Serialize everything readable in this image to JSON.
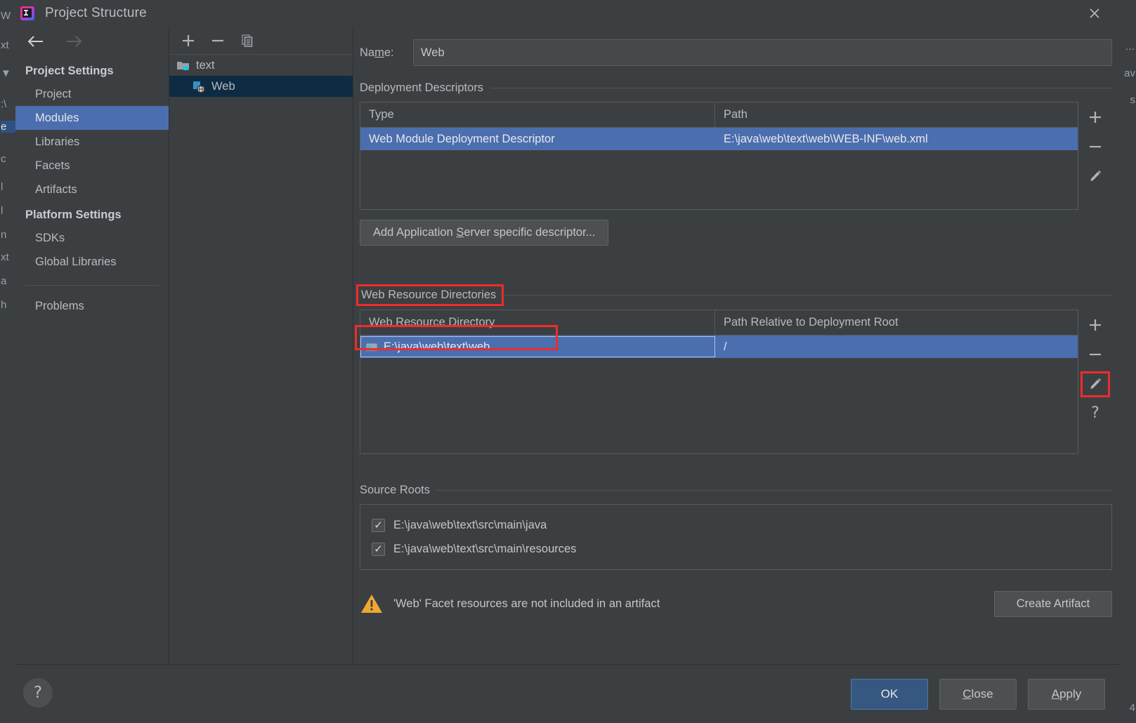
{
  "window": {
    "title": "Project Structure",
    "app_icon": "intellij-idea-icon",
    "close_icon": "close-icon"
  },
  "sidebar": {
    "back_icon": "arrow-left-icon",
    "forward_icon": "arrow-right-icon",
    "groups": [
      {
        "title": "Project Settings",
        "items": [
          {
            "label": "Project",
            "selected": false
          },
          {
            "label": "Modules",
            "selected": true
          },
          {
            "label": "Libraries",
            "selected": false
          },
          {
            "label": "Facets",
            "selected": false
          },
          {
            "label": "Artifacts",
            "selected": false
          }
        ]
      },
      {
        "title": "Platform Settings",
        "items": [
          {
            "label": "SDKs",
            "selected": false
          },
          {
            "label": "Global Libraries",
            "selected": false
          }
        ]
      }
    ],
    "problems": {
      "label": "Problems",
      "selected": false
    }
  },
  "tree_panel": {
    "toolbar": {
      "add_label": "+",
      "remove_label": "−",
      "copy_label": "copy-icon"
    },
    "nodes": [
      {
        "label": "text",
        "icon": "module-folder-icon",
        "selected": false,
        "child": false
      },
      {
        "label": "Web",
        "icon": "web-facet-icon",
        "selected": true,
        "child": true
      }
    ]
  },
  "detail": {
    "name": {
      "label_pre": "Na",
      "label_mnemonic": "m",
      "label_post": "e:",
      "value": "Web",
      "placeholder": ""
    },
    "deployment_descriptors": {
      "section_title": "Deployment Descriptors",
      "columns": [
        "Type",
        "Path"
      ],
      "rows": [
        {
          "type": "Web Module Deployment Descriptor",
          "path": "E:\\java\\web\\text\\web\\WEB-INF\\web.xml",
          "selected": true
        }
      ],
      "toolbar": {
        "add": "+",
        "remove": "−",
        "edit": "pencil-icon"
      }
    },
    "add_descriptor_button": {
      "text_pre": "Add Application ",
      "text_mnemonic": "S",
      "text_post": "erver specific descriptor..."
    },
    "web_resource_directories": {
      "section_title": "Web Resource Directories",
      "section_highlighted": true,
      "columns": [
        "Web Resource Directory",
        "Path Relative to Deployment Root"
      ],
      "rows": [
        {
          "directory": "E:\\java\\web\\text\\web",
          "relative_path": "/",
          "selected": true,
          "editing": true,
          "highlighted": true,
          "icon": "folder-blue-icon"
        }
      ],
      "toolbar": {
        "add": "+",
        "remove": "−",
        "edit": "pencil-icon",
        "edit_highlighted": true,
        "help": "?"
      }
    },
    "source_roots": {
      "section_title": "Source Roots",
      "items": [
        {
          "label": "E:\\java\\web\\text\\src\\main\\java",
          "checked": true
        },
        {
          "label": "E:\\java\\web\\text\\src\\main\\resources",
          "checked": true
        }
      ],
      "check_glyph": "✓"
    },
    "warning": {
      "icon": "warning-triangle-icon",
      "text": "'Web' Facet resources are not included in an artifact",
      "action_label": "Create Artifact"
    }
  },
  "bottom_bar": {
    "help_icon": "question-mark-icon",
    "buttons": [
      {
        "label": "OK",
        "mnemonic": "",
        "style": "primary"
      },
      {
        "label": "Close",
        "mnemonic": "C",
        "style": "normal"
      },
      {
        "label": "Apply",
        "mnemonic": "A",
        "style": "normal"
      }
    ]
  },
  "background_ide": {
    "left_fragments": [
      "W",
      "xt",
      "▼",
      ":\\",
      "e",
      "c",
      "l",
      "l",
      "n",
      "xt",
      "a",
      "h"
    ],
    "right_fragments": [
      "…",
      "av",
      "s",
      "4"
    ]
  },
  "colors": {
    "dialog_bg": "#3c3f41",
    "selection_blue": "#4b6eaf",
    "tree_selection": "#0d2c43",
    "primary_button": "#365880",
    "highlight_red": "#ef2b2b",
    "warning_orange": "#f0a732",
    "text_primary": "#b6babe"
  }
}
